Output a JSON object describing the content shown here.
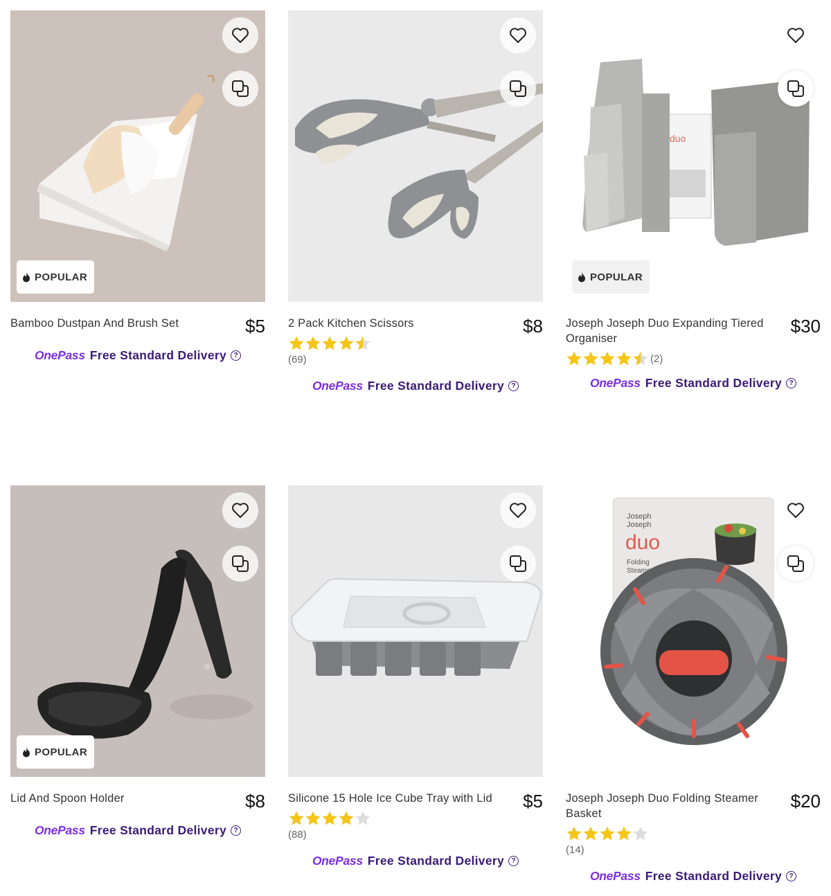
{
  "badges": {
    "popular": "POPULAR"
  },
  "delivery": {
    "brand": "OnePass",
    "text": "Free Standard Delivery",
    "help": "?"
  },
  "icons": {
    "favourite": "heart-icon",
    "compare": "compare-icon",
    "popular": "flame-icon",
    "rating": "star-icon"
  },
  "colors": {
    "star": "#f5c518",
    "star_empty": "#dddddd",
    "onepass_brand": "#7b2fe0",
    "onepass_text": "#3a1a78"
  },
  "products": [
    {
      "title": "Bamboo Dustpan And Brush Set",
      "price": "$5",
      "badge": "POPULAR",
      "rating": null,
      "review_count": ""
    },
    {
      "title": "2 Pack Kitchen Scissors",
      "price": "$8",
      "badge": "",
      "rating": 4.5,
      "review_count": "(69)"
    },
    {
      "title": "Joseph Joseph Duo Expanding Tiered Organiser",
      "price": "$30",
      "badge": "POPULAR",
      "rating": 4.5,
      "review_count": "(2)"
    },
    {
      "title": "Lid And Spoon Holder",
      "price": "$8",
      "badge": "POPULAR",
      "rating": null,
      "review_count": ""
    },
    {
      "title": "Silicone 15 Hole Ice Cube Tray with Lid",
      "price": "$5",
      "badge": "",
      "rating": 4.0,
      "review_count": "(88)"
    },
    {
      "title": "Joseph Joseph Duo Folding Steamer Basket",
      "price": "$20",
      "badge": "",
      "rating": 4.0,
      "review_count": "(14)"
    }
  ],
  "steamer_packaging": {
    "brand_line1": "Joseph",
    "brand_line2": "Joseph",
    "logo": "duo",
    "product_line1": "Folding",
    "product_line2": "Steamer Basket"
  },
  "organiser_packaging": {
    "logo": "duo"
  }
}
